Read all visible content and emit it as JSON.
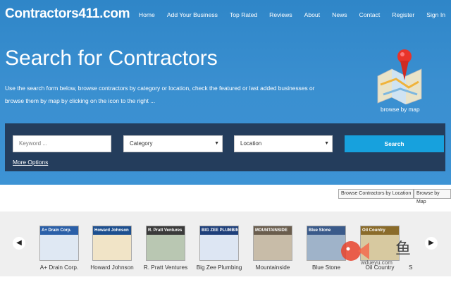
{
  "header": {
    "logo": "Contractors411.com",
    "nav": [
      "Home",
      "Add Your Business",
      "Top Rated",
      "Reviews",
      "About",
      "News",
      "Contact",
      "Register",
      "Sign In"
    ]
  },
  "hero": {
    "title": "Search for Contractors",
    "description": "Use the search form below, browse contractors by category or location, check the featured or last added businesses or browse them by map by clicking on the icon to the right ...",
    "map_label": "browse by map"
  },
  "search": {
    "keyword_placeholder": "Keyword ...",
    "category": "Category",
    "location": "Location",
    "button": "Search",
    "more": "More Options"
  },
  "browse": {
    "by_location": "Browse Contractors by Location",
    "by_map": "Browse by Map"
  },
  "carousel": {
    "items": [
      {
        "name": "A+ Drain Corp.",
        "thumb": "A+ Drain Corp.",
        "color": "#2a5fa8"
      },
      {
        "name": "Howard Johnson",
        "thumb": "Howard Johnson",
        "color": "#1d4f8f"
      },
      {
        "name": "R. Pratt Ventures",
        "thumb": "R. Pratt Ventures",
        "color": "#3a3a3a"
      },
      {
        "name": "Big Zee Plumbing",
        "thumb": "BIG ZEE PLUMBING",
        "color": "#1e3f7a"
      },
      {
        "name": "Mountainside",
        "thumb": "MOUNTAINSIDE",
        "color": "#6a5d4d"
      },
      {
        "name": "Blue Stone",
        "thumb": "Blue Stone",
        "color": "#3a5a8a"
      },
      {
        "name": "Oil Country",
        "thumb": "Oil Country",
        "color": "#8a6b2a"
      }
    ],
    "partial": "S"
  },
  "watermark": {
    "cn": "鱼",
    "url": "wdueyu.com"
  }
}
